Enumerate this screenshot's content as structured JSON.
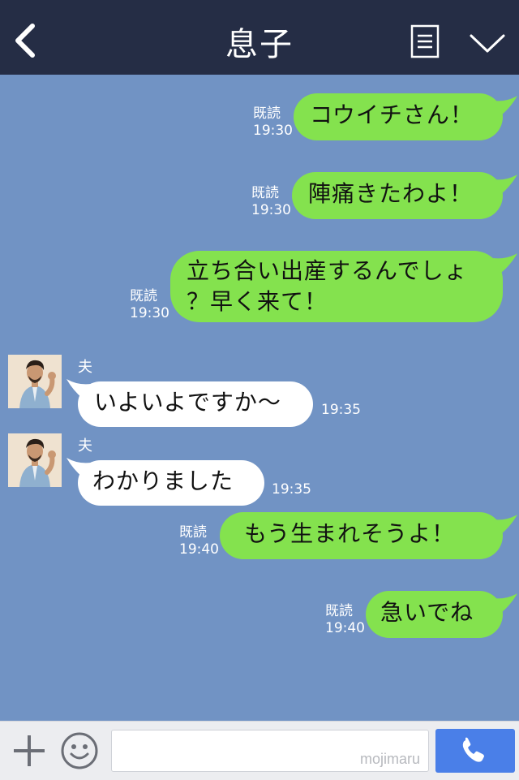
{
  "header": {
    "title": "息子"
  },
  "messages": [
    {
      "sender": "me",
      "text": "コウイチさん！",
      "read": "既読",
      "time": "19:30"
    },
    {
      "sender": "me",
      "text": "陣痛きたわよ！",
      "read": "既読",
      "time": "19:30"
    },
    {
      "sender": "me",
      "text_line1": "立ち合い出産するんでしょ",
      "text_line2": "？早く来て！",
      "read": "既読",
      "time": "19:30"
    },
    {
      "sender": "them",
      "name": "夫",
      "text": "いよいよですか〜",
      "time": "19:35"
    },
    {
      "sender": "them",
      "name": "夫",
      "text": "わかりました",
      "time": "19:35"
    },
    {
      "sender": "me",
      "text": "もう生まれそうよ！",
      "read": "既読",
      "time": "19:40"
    },
    {
      "sender": "me",
      "text": "急いでね",
      "read": "既読",
      "time": "19:40"
    }
  ],
  "input": {
    "placeholder": "",
    "watermark": "mojimaru"
  },
  "colors": {
    "header": "#252d45",
    "background": "#7193c4",
    "my_bubble": "#84e24e",
    "their_bubble": "#ffffff",
    "call_button": "#4a7fe8"
  },
  "icons": [
    "back-chevron-icon",
    "menu-list-icon",
    "chevron-down-icon",
    "plus-icon",
    "emoji-icon",
    "phone-icon"
  ]
}
